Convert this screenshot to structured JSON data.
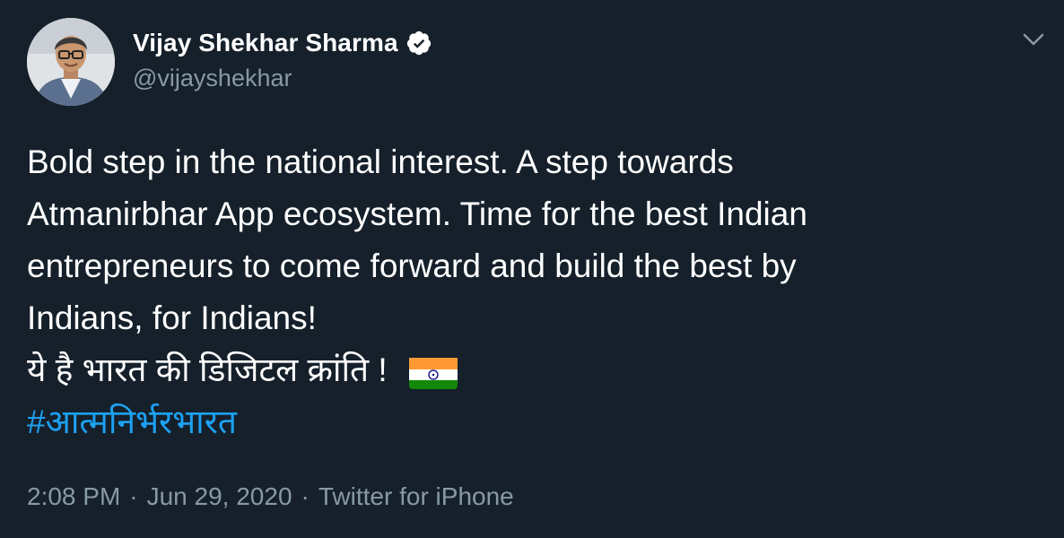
{
  "author": {
    "display_name": "Vijay Shekhar Sharma",
    "handle": "@vijayshekhar",
    "verified": true,
    "avatar_icon": "profile-photo"
  },
  "tweet": {
    "lines": [
      "Bold step in the national interest. A step towards",
      "Atmanirbhar App ecosystem. Time for the best Indian",
      "entrepreneurs to come forward and build the best by",
      "Indians, for Indians!"
    ],
    "hindi_line": "ये है भारत की डिजिटल क्रांति !",
    "hindi_emoji": "india-flag",
    "hashtag": "#आत्मनिर्भरभारत"
  },
  "meta": {
    "time": "2:08 PM",
    "separator": "·",
    "date": "Jun 29, 2020",
    "source": "Twitter for iPhone"
  },
  "icons": {
    "menu": "chevron-down-icon",
    "verified": "verified-badge-icon"
  },
  "colors": {
    "background": "#15202b",
    "text": "#ffffff",
    "secondary": "#8899a6",
    "link": "#1da1f2"
  }
}
